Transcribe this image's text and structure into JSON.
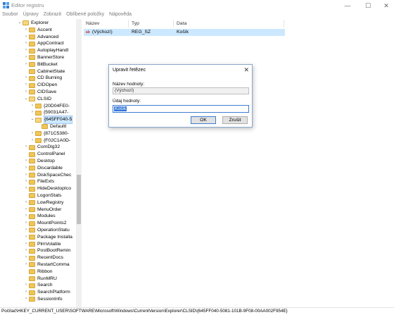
{
  "window": {
    "title": "Editor registru",
    "minimize_glyph": "—",
    "maximize_glyph": "☐",
    "close_glyph": "✕"
  },
  "menu": [
    "Soubor",
    "Úpravy",
    "Zobrazit",
    "Oblíbené položky",
    "Nápověda"
  ],
  "tree": {
    "items": [
      {
        "label": "Explorer",
        "chev": "⌄",
        "level": 0,
        "open": true
      },
      {
        "label": "Accent",
        "chev": "›",
        "level": 1
      },
      {
        "label": "Advanced",
        "chev": "›",
        "level": 1
      },
      {
        "label": "AppContract",
        "chev": "›",
        "level": 1
      },
      {
        "label": "AutoplayHandl",
        "chev": "›",
        "level": 1
      },
      {
        "label": "BannerStore",
        "chev": "›",
        "level": 1
      },
      {
        "label": "BitBucket",
        "chev": "›",
        "level": 1
      },
      {
        "label": "CabinetState",
        "chev": "",
        "level": 1
      },
      {
        "label": "CD Burning",
        "chev": "›",
        "level": 1
      },
      {
        "label": "CIDOpen",
        "chev": "›",
        "level": 1
      },
      {
        "label": "CIDSave",
        "chev": "›",
        "level": 1
      },
      {
        "label": "CLSID",
        "chev": "⌄",
        "level": 1,
        "open": true
      },
      {
        "label": "{20D04FE0-",
        "chev": "›",
        "level": 2
      },
      {
        "label": "{59031A47-",
        "chev": "›",
        "level": 2
      },
      {
        "label": "{645FF040-5",
        "chev": "⌄",
        "level": 2,
        "open": true,
        "selected": true
      },
      {
        "label": "DefaultI",
        "chev": "",
        "level": 3
      },
      {
        "label": "{871C5380-",
        "chev": "›",
        "level": 2
      },
      {
        "label": "{F02C1A0D-",
        "chev": "›",
        "level": 2
      },
      {
        "label": "ComDlg32",
        "chev": "›",
        "level": 1
      },
      {
        "label": "ControlPanel",
        "chev": "",
        "level": 1
      },
      {
        "label": "Desktop",
        "chev": "›",
        "level": 1
      },
      {
        "label": "Discardable",
        "chev": "›",
        "level": 1
      },
      {
        "label": "DiskSpaceChec",
        "chev": "›",
        "level": 1
      },
      {
        "label": "FileExts",
        "chev": "›",
        "level": 1
      },
      {
        "label": "HideDesktopIco",
        "chev": "›",
        "level": 1
      },
      {
        "label": "LogonStats",
        "chev": "",
        "level": 1
      },
      {
        "label": "LowRegistry",
        "chev": "›",
        "level": 1
      },
      {
        "label": "MenuOrder",
        "chev": "›",
        "level": 1
      },
      {
        "label": "Modules",
        "chev": "›",
        "level": 1
      },
      {
        "label": "MountPoints2",
        "chev": "›",
        "level": 1
      },
      {
        "label": "OperationStatu",
        "chev": "›",
        "level": 1
      },
      {
        "label": "Package Installa",
        "chev": "›",
        "level": 1
      },
      {
        "label": "PlmVolatile",
        "chev": "›",
        "level": 1
      },
      {
        "label": "PostBootRemin",
        "chev": "›",
        "level": 1
      },
      {
        "label": "RecentDocs",
        "chev": "›",
        "level": 1
      },
      {
        "label": "RestartComma",
        "chev": "›",
        "level": 1
      },
      {
        "label": "Ribbon",
        "chev": "",
        "level": 1
      },
      {
        "label": "RunMRU",
        "chev": "",
        "level": 1
      },
      {
        "label": "Search",
        "chev": "›",
        "level": 1
      },
      {
        "label": "SearchPlatform",
        "chev": "›",
        "level": 1
      },
      {
        "label": "SessionInfo",
        "chev": "›",
        "level": 1
      }
    ]
  },
  "list": {
    "columns": [
      "Název",
      "Typ",
      "Data"
    ],
    "rows": [
      {
        "name": "(Výchozí)",
        "type": "REG_SZ",
        "data": "Koš1k"
      }
    ],
    "value_icon": "ab"
  },
  "dialog": {
    "title": "Upravit řetězec",
    "close_glyph": "✕",
    "name_label": "Název hodnoty:",
    "name_value": "(Výchozí)",
    "data_label": "Údaj hodnoty:",
    "data_value": "Košík",
    "ok_label": "OK",
    "cancel_label": "Zrušit"
  },
  "status": {
    "path": "Počítač\\HKEY_CURRENT_USER\\SOFTWARE\\Microsoft\\Windows\\CurrentVersion\\Explorer\\CLSID\\{645FF040-5081-101B-9F08-00AA002F954E}"
  }
}
